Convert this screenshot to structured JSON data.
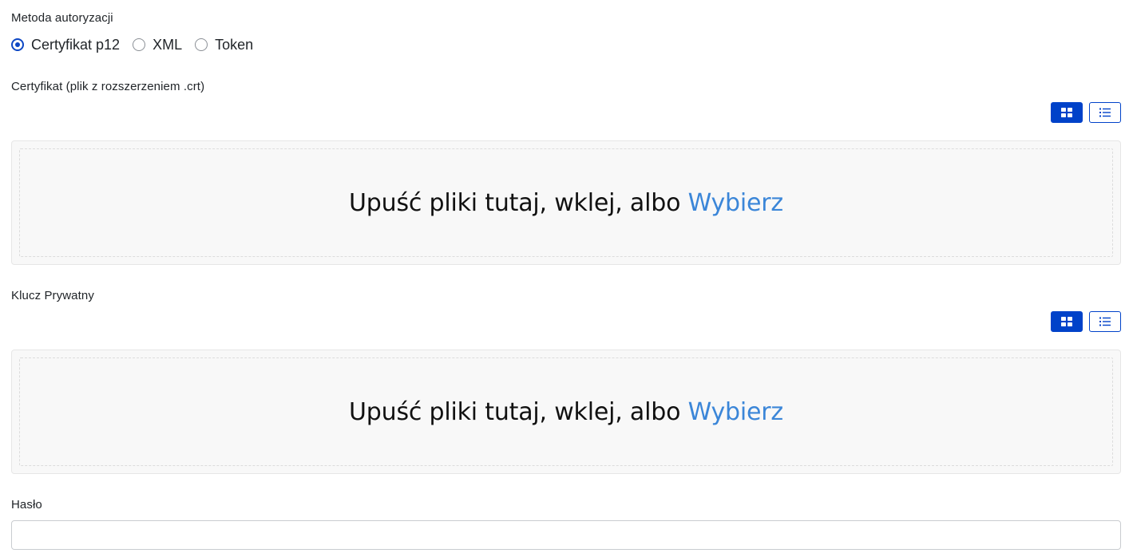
{
  "auth": {
    "label": "Metoda autoryzacji",
    "options": [
      {
        "label": "Certyfikat p12",
        "checked": true
      },
      {
        "label": "XML",
        "checked": false
      },
      {
        "label": "Token",
        "checked": false
      }
    ]
  },
  "certificate": {
    "label": "Certyfikat (plik z rozszerzeniem .crt)",
    "drop_text": "Upuść pliki tutaj, wklej, albo ",
    "browse_label": "Wybierz"
  },
  "private_key": {
    "label": "Klucz Prywatny",
    "drop_text": "Upuść pliki tutaj, wklej, albo ",
    "browse_label": "Wybierz"
  },
  "password": {
    "label": "Hasło",
    "value": ""
  },
  "view_toggle": {
    "grid_icon": "grid-icon",
    "list_icon": "list-icon",
    "active": "grid"
  },
  "colors": {
    "primary": "#0042c9",
    "link": "#3b86d8",
    "dropzone_bg": "#f8f8f8"
  }
}
